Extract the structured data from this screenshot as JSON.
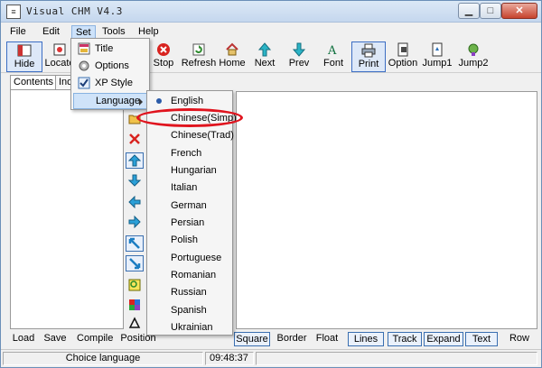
{
  "window": {
    "title": "Visual CHM V4.3",
    "app_icon": "chm-app-icon"
  },
  "title_buttons": {
    "minimize": "▁",
    "maximize": "□",
    "close": "✕"
  },
  "menubar": [
    {
      "key": "file",
      "label": "File"
    },
    {
      "key": "edit",
      "label": "Edit"
    },
    {
      "key": "set",
      "label": "Set"
    },
    {
      "key": "tools",
      "label": "Tools"
    },
    {
      "key": "help",
      "label": "Help"
    }
  ],
  "toolbar": {
    "hide": "Hide",
    "locate": "Locate",
    "stop": "Stop",
    "refresh": "Refresh",
    "home": "Home",
    "next": "Next",
    "prev": "Prev",
    "font": "Font",
    "print": "Print",
    "option": "Option",
    "jump1": "Jump1",
    "jump2": "Jump2"
  },
  "left_tabs": {
    "contents": "Contents",
    "index": "Ind"
  },
  "set_menu": {
    "title": "Title",
    "options": "Options",
    "xp_style": "XP Style",
    "language": "Language"
  },
  "language_menu": {
    "selected": "English",
    "items": [
      "English",
      "Chinese(Simp)",
      "Chinese(Trad)",
      "French",
      "Hungarian",
      "Italian",
      "German",
      "Persian",
      "Polish",
      "Portuguese",
      "Romanian",
      "Russian",
      "Spanish",
      "Ukrainian"
    ]
  },
  "bottom_toolbar": {
    "load": "Load",
    "save": "Save",
    "compile": "Compile",
    "position": "Position",
    "square": "Square",
    "border": "Border",
    "float": "Float",
    "lines": "Lines",
    "track": "Track",
    "expand": "Expand",
    "text": "Text",
    "row": "Row"
  },
  "statusbar": {
    "message": "Choice language",
    "time": "09:48:37"
  },
  "colors": {
    "highlight_ellipse": "#e0141e",
    "menu_highlight": "#cfe3f9"
  }
}
